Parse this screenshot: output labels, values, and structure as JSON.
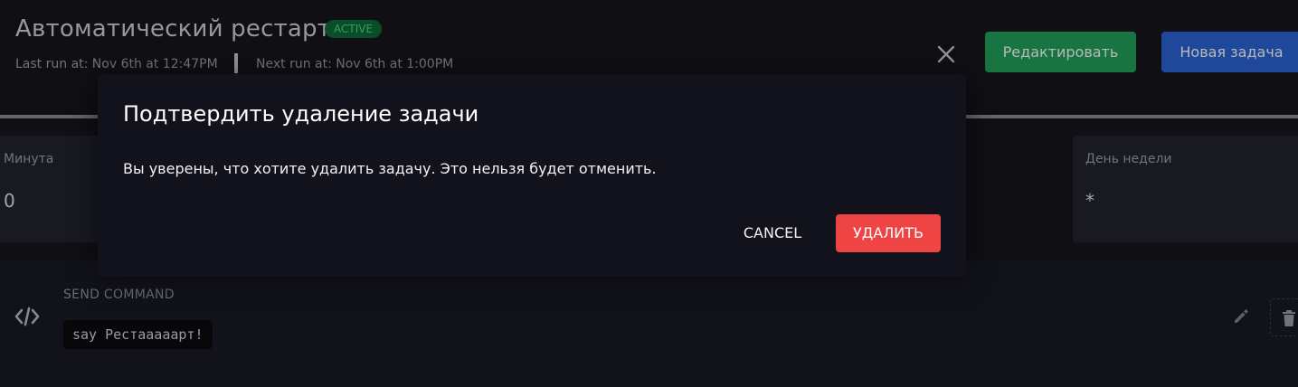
{
  "header": {
    "title": "Автоматический рестарт",
    "status_badge": "ACTIVE",
    "last_run": "Last run at: Nov 6th at 12:47PM",
    "next_run": "Next run at: Nov 6th at 1:00PM"
  },
  "toolbar": {
    "edit_label": "Редактировать",
    "new_task_label": "Новая задача"
  },
  "schedule": {
    "minute_label": "Минута",
    "minute_value": "0",
    "dow_label": "День недели",
    "dow_value": "*"
  },
  "task": {
    "type": "SEND COMMAND",
    "command": "say Рестааааарт!"
  },
  "modal": {
    "title": "Подтвердить удаление задачи",
    "message": "Вы уверены, что хотите удалить задачу. Это нельзя будет отменить.",
    "cancel_label": "CANCEL",
    "delete_label": "УДАЛИТЬ"
  },
  "icons": {
    "close": "close-icon",
    "code": "code-icon",
    "pencil": "pencil-icon",
    "trash": "trash-icon"
  },
  "colors": {
    "background": "#15151d",
    "modal_background": "#12121c",
    "active_badge_bg": "#0f6b3c",
    "active_badge_text": "#46d98e",
    "edit_button": "#22a35a",
    "new_task_button": "#2c63d6",
    "delete_button": "#ef4444"
  }
}
